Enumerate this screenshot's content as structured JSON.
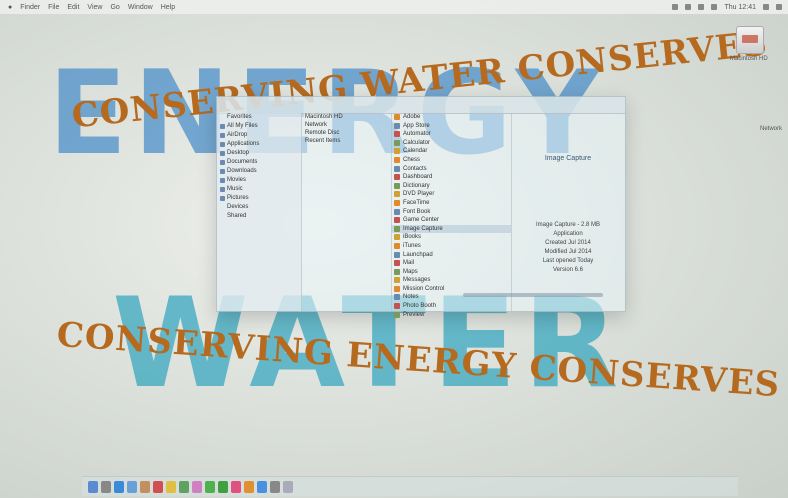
{
  "menubar": {
    "items": [
      "Finder",
      "File",
      "Edit",
      "View",
      "Go",
      "Window",
      "Help"
    ],
    "status_text": "Thu 12:41"
  },
  "wallpaper": {
    "word_top": "ENERGY",
    "word_bottom": "WATER",
    "arc_top": "CONSERVING WATER CONSERVES",
    "arc_bottom": "CONSERVING ENERGY CONSERVES",
    "colors": {
      "top": "#468cc8",
      "bottom": "#32a5be",
      "arc": "#b56a1f"
    }
  },
  "finder": {
    "sidebar": [
      "Favorites",
      "All My Files",
      "AirDrop",
      "Applications",
      "Desktop",
      "Documents",
      "Downloads",
      "Movies",
      "Music",
      "Pictures",
      "Devices",
      "Shared"
    ],
    "column2": [
      "Macintosh HD",
      "Network",
      "Remote Disc",
      "Recent Items"
    ],
    "column3": [
      "Adobe",
      "App Store",
      "Automator",
      "Calculator",
      "Calendar",
      "Chess",
      "Contacts",
      "Dashboard",
      "Dictionary",
      "DVD Player",
      "FaceTime",
      "Font Book",
      "Game Center",
      "Image Capture",
      "iBooks",
      "iTunes",
      "Launchpad",
      "Mail",
      "Maps",
      "Messages",
      "Mission Control",
      "Notes",
      "Photo Booth",
      "Preview"
    ],
    "selected_index": 13,
    "preview": {
      "title": "Image Capture",
      "lines": [
        "Image Capture - 2.8 MB",
        "Application",
        "Created Jul 2014",
        "Modified Jul 2014",
        "Last opened Today",
        "Version 6.6"
      ]
    }
  },
  "desktop": {
    "hd_label": "Macintosh HD",
    "side_label": "Network"
  },
  "dock": {
    "icons": [
      "finder-icon",
      "launchpad-icon",
      "safari-icon",
      "mail-icon",
      "contacts-icon",
      "calendar-icon",
      "notes-icon",
      "maps-icon",
      "photos-icon",
      "messages-icon",
      "facetime-icon",
      "itunes-icon",
      "ibooks-icon",
      "appstore-icon",
      "preferences-icon",
      "trash-icon"
    ]
  }
}
